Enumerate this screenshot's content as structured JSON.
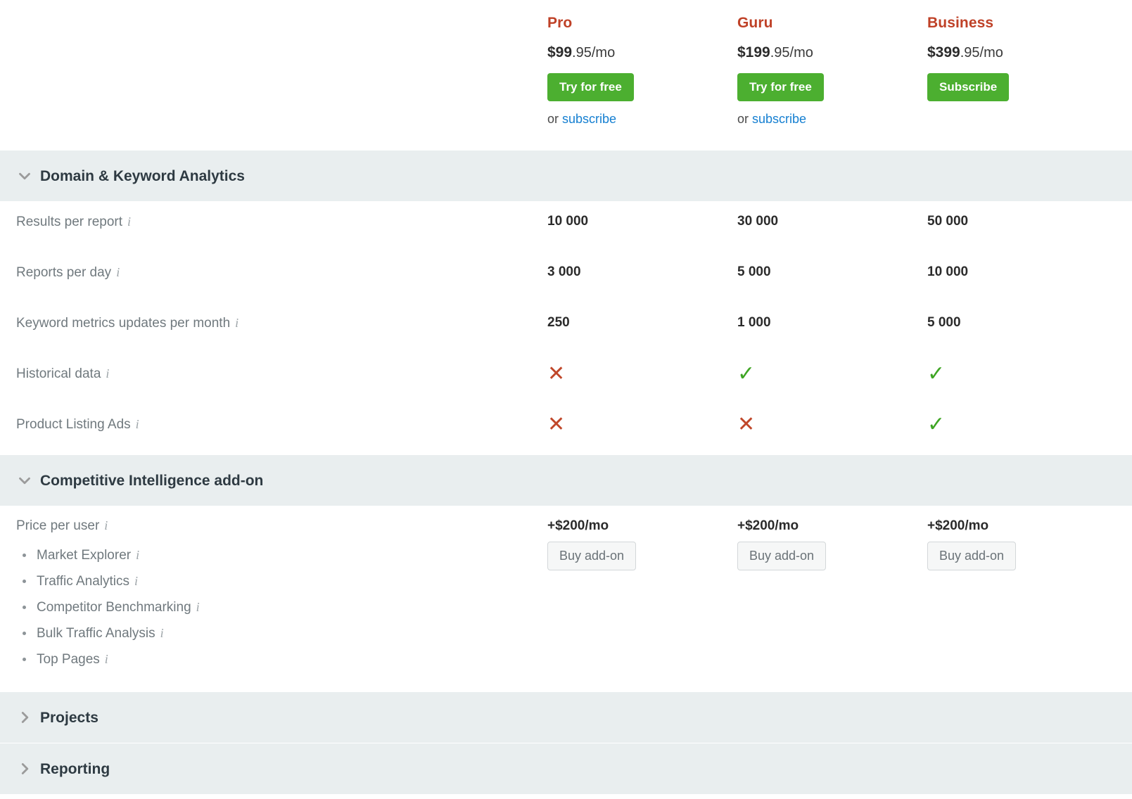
{
  "plans": [
    {
      "name": "Pro",
      "price_amount": "$99",
      "price_cents": ".95/mo",
      "cta_label": "Try for free",
      "or_text": "or ",
      "subscribe_label": "subscribe",
      "has_subscribe_link": true
    },
    {
      "name": "Guru",
      "price_amount": "$199",
      "price_cents": ".95/mo",
      "cta_label": "Try for free",
      "or_text": "or ",
      "subscribe_label": "subscribe",
      "has_subscribe_link": true
    },
    {
      "name": "Business",
      "price_amount": "$399",
      "price_cents": ".95/mo",
      "cta_label": "Subscribe",
      "or_text": "",
      "subscribe_label": "",
      "has_subscribe_link": false
    }
  ],
  "sections": [
    {
      "title": "Domain & Keyword Analytics",
      "expanded": true,
      "chevron": "chevron-down-icon"
    },
    {
      "title": "Competitive Intelligence add-on",
      "expanded": true,
      "chevron": "chevron-down-icon"
    },
    {
      "title": "Projects",
      "expanded": false,
      "chevron": "chevron-right-icon"
    },
    {
      "title": "Reporting",
      "expanded": false,
      "chevron": "chevron-right-icon"
    }
  ],
  "analytics_rows": [
    {
      "label": "Results per report",
      "info": "i",
      "pro": "10 000",
      "guru": "30 000",
      "business": "50 000",
      "type": "text"
    },
    {
      "label": "Reports per day",
      "info": "i",
      "pro": "3 000",
      "guru": "5 000",
      "business": "10 000",
      "type": "text"
    },
    {
      "label": "Keyword metrics updates per month",
      "info": "i",
      "pro": "250",
      "guru": "1 000",
      "business": "5 000",
      "type": "text"
    },
    {
      "label": "Historical data",
      "info": "i",
      "pro": "✕",
      "guru": "✓",
      "business": "✓",
      "type": "mark",
      "pro_state": "no",
      "guru_state": "yes",
      "business_state": "yes"
    },
    {
      "label": "Product Listing Ads",
      "info": "i",
      "pro": "✕",
      "guru": "✕",
      "business": "✓",
      "type": "mark",
      "pro_state": "no",
      "guru_state": "no",
      "business_state": "yes"
    }
  ],
  "addon": {
    "price_label": "Price per user",
    "price_info": "i",
    "sub_features": [
      {
        "label": "Market Explorer",
        "info": "i"
      },
      {
        "label": "Traffic Analytics",
        "info": "i"
      },
      {
        "label": "Competitor Benchmarking",
        "info": "i"
      },
      {
        "label": "Bulk Traffic Analysis",
        "info": "i"
      },
      {
        "label": "Top Pages",
        "info": "i"
      }
    ],
    "prices": {
      "pro": "+$200/mo",
      "guru": "+$200/mo",
      "business": "+$200/mo"
    },
    "buy_label": "Buy add-on"
  },
  "colors": {
    "plan_name": "#bf4127",
    "cta_green": "#4caf30",
    "link_blue": "#157fd1",
    "section_bg": "#e9eeef",
    "check_green": "#3fa524",
    "cross_red": "#c0472a",
    "label_gray": "#70797e",
    "value_dark": "#2b2b2b"
  }
}
